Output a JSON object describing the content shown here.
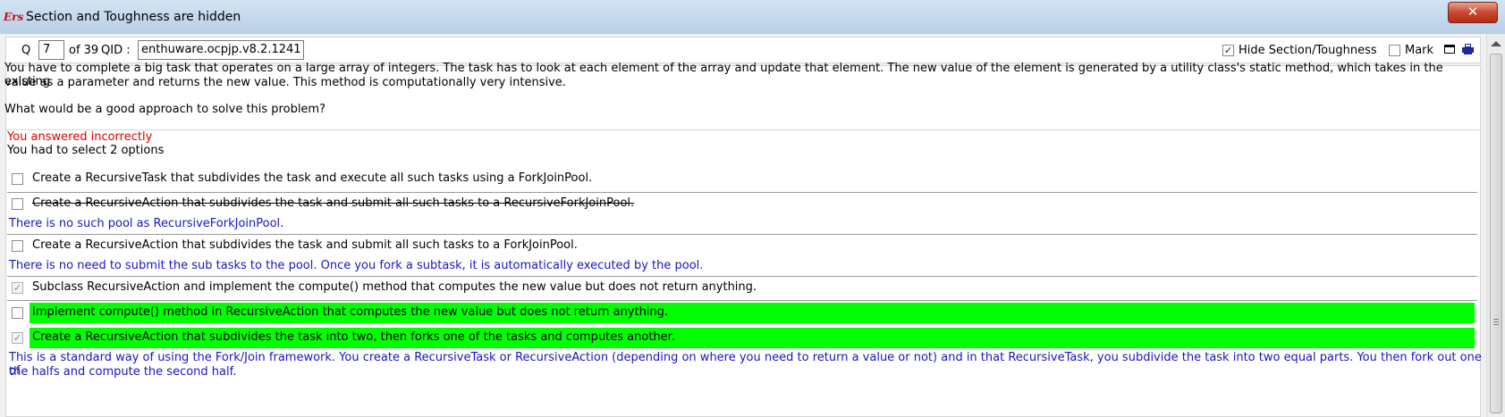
{
  "window": {
    "title": "Section and Toughness are hidden",
    "app_icon": "Ers",
    "close_symbol": "✕"
  },
  "header": {
    "q_label": "Q",
    "q_value": "7",
    "of_label": "of 39",
    "qid_label": "QID :",
    "qid_value": "enthuware.ocpjp.v8.2.1241",
    "hide_label": "Hide Section/Toughness",
    "hide_checked": true,
    "mark_label": "Mark",
    "mark_checked": false
  },
  "question": {
    "line1": "You have to complete a big task that operates on a large array of integers. The task has to look at each element of the array and update that element. The new value of the element is generated by a utility class's static method, which takes in the existing",
    "line2": "value as a parameter and returns the new value. This method is computationally very intensive.",
    "line3": "What would be a good approach to solve this problem?"
  },
  "answers": {
    "result": "You answered incorrectly",
    "select_info": "You had to select 2 options",
    "options": [
      {
        "text": "Create a RecursiveTask that subdivides the task and execute all such tasks using a ForkJoinPool.",
        "checked": false
      },
      {
        "text": "Create a RecursiveAction that subdivides the task and submit all such tasks to a RecursiveForkJoinPool.",
        "checked": false,
        "explanation": "There is no such pool as RecursiveForkJoinPool."
      },
      {
        "text": "Create a RecursiveAction that subdivides the task and submit all such tasks to a ForkJoinPool.",
        "checked": false,
        "explanation": "There is no need to submit the sub tasks to the pool. Once you fork a subtask, it is automatically executed by the pool."
      },
      {
        "text": "Subclass RecursiveAction and implement the compute() method that computes the new value but does not return anything.",
        "checked": true
      },
      {
        "text": "Implement compute() method in RecursiveAction that computes the new value but does not return anything.",
        "checked": false
      },
      {
        "text": "Create a RecursiveAction that subdivides the task into two, then forks one of the tasks and computes another.",
        "checked": true,
        "explanation_line1": "This is a standard way of using the Fork/Join framework. You create a RecursiveTask or RecursiveAction (depending on where you need to return a value or not) and in that RecursiveTask, you subdivide the task into two equal parts. You then fork out one of",
        "explanation_line2": "the halfs and compute the second half."
      }
    ]
  },
  "colors": {
    "correct_highlight": "#00ff00",
    "incorrect_text": "#e00000",
    "explanation_text": "#1616c8"
  },
  "icons": [
    "app-logo-icon",
    "close-icon",
    "window-icon",
    "print-icon",
    "check-icon",
    "scroll-up-icon"
  ]
}
